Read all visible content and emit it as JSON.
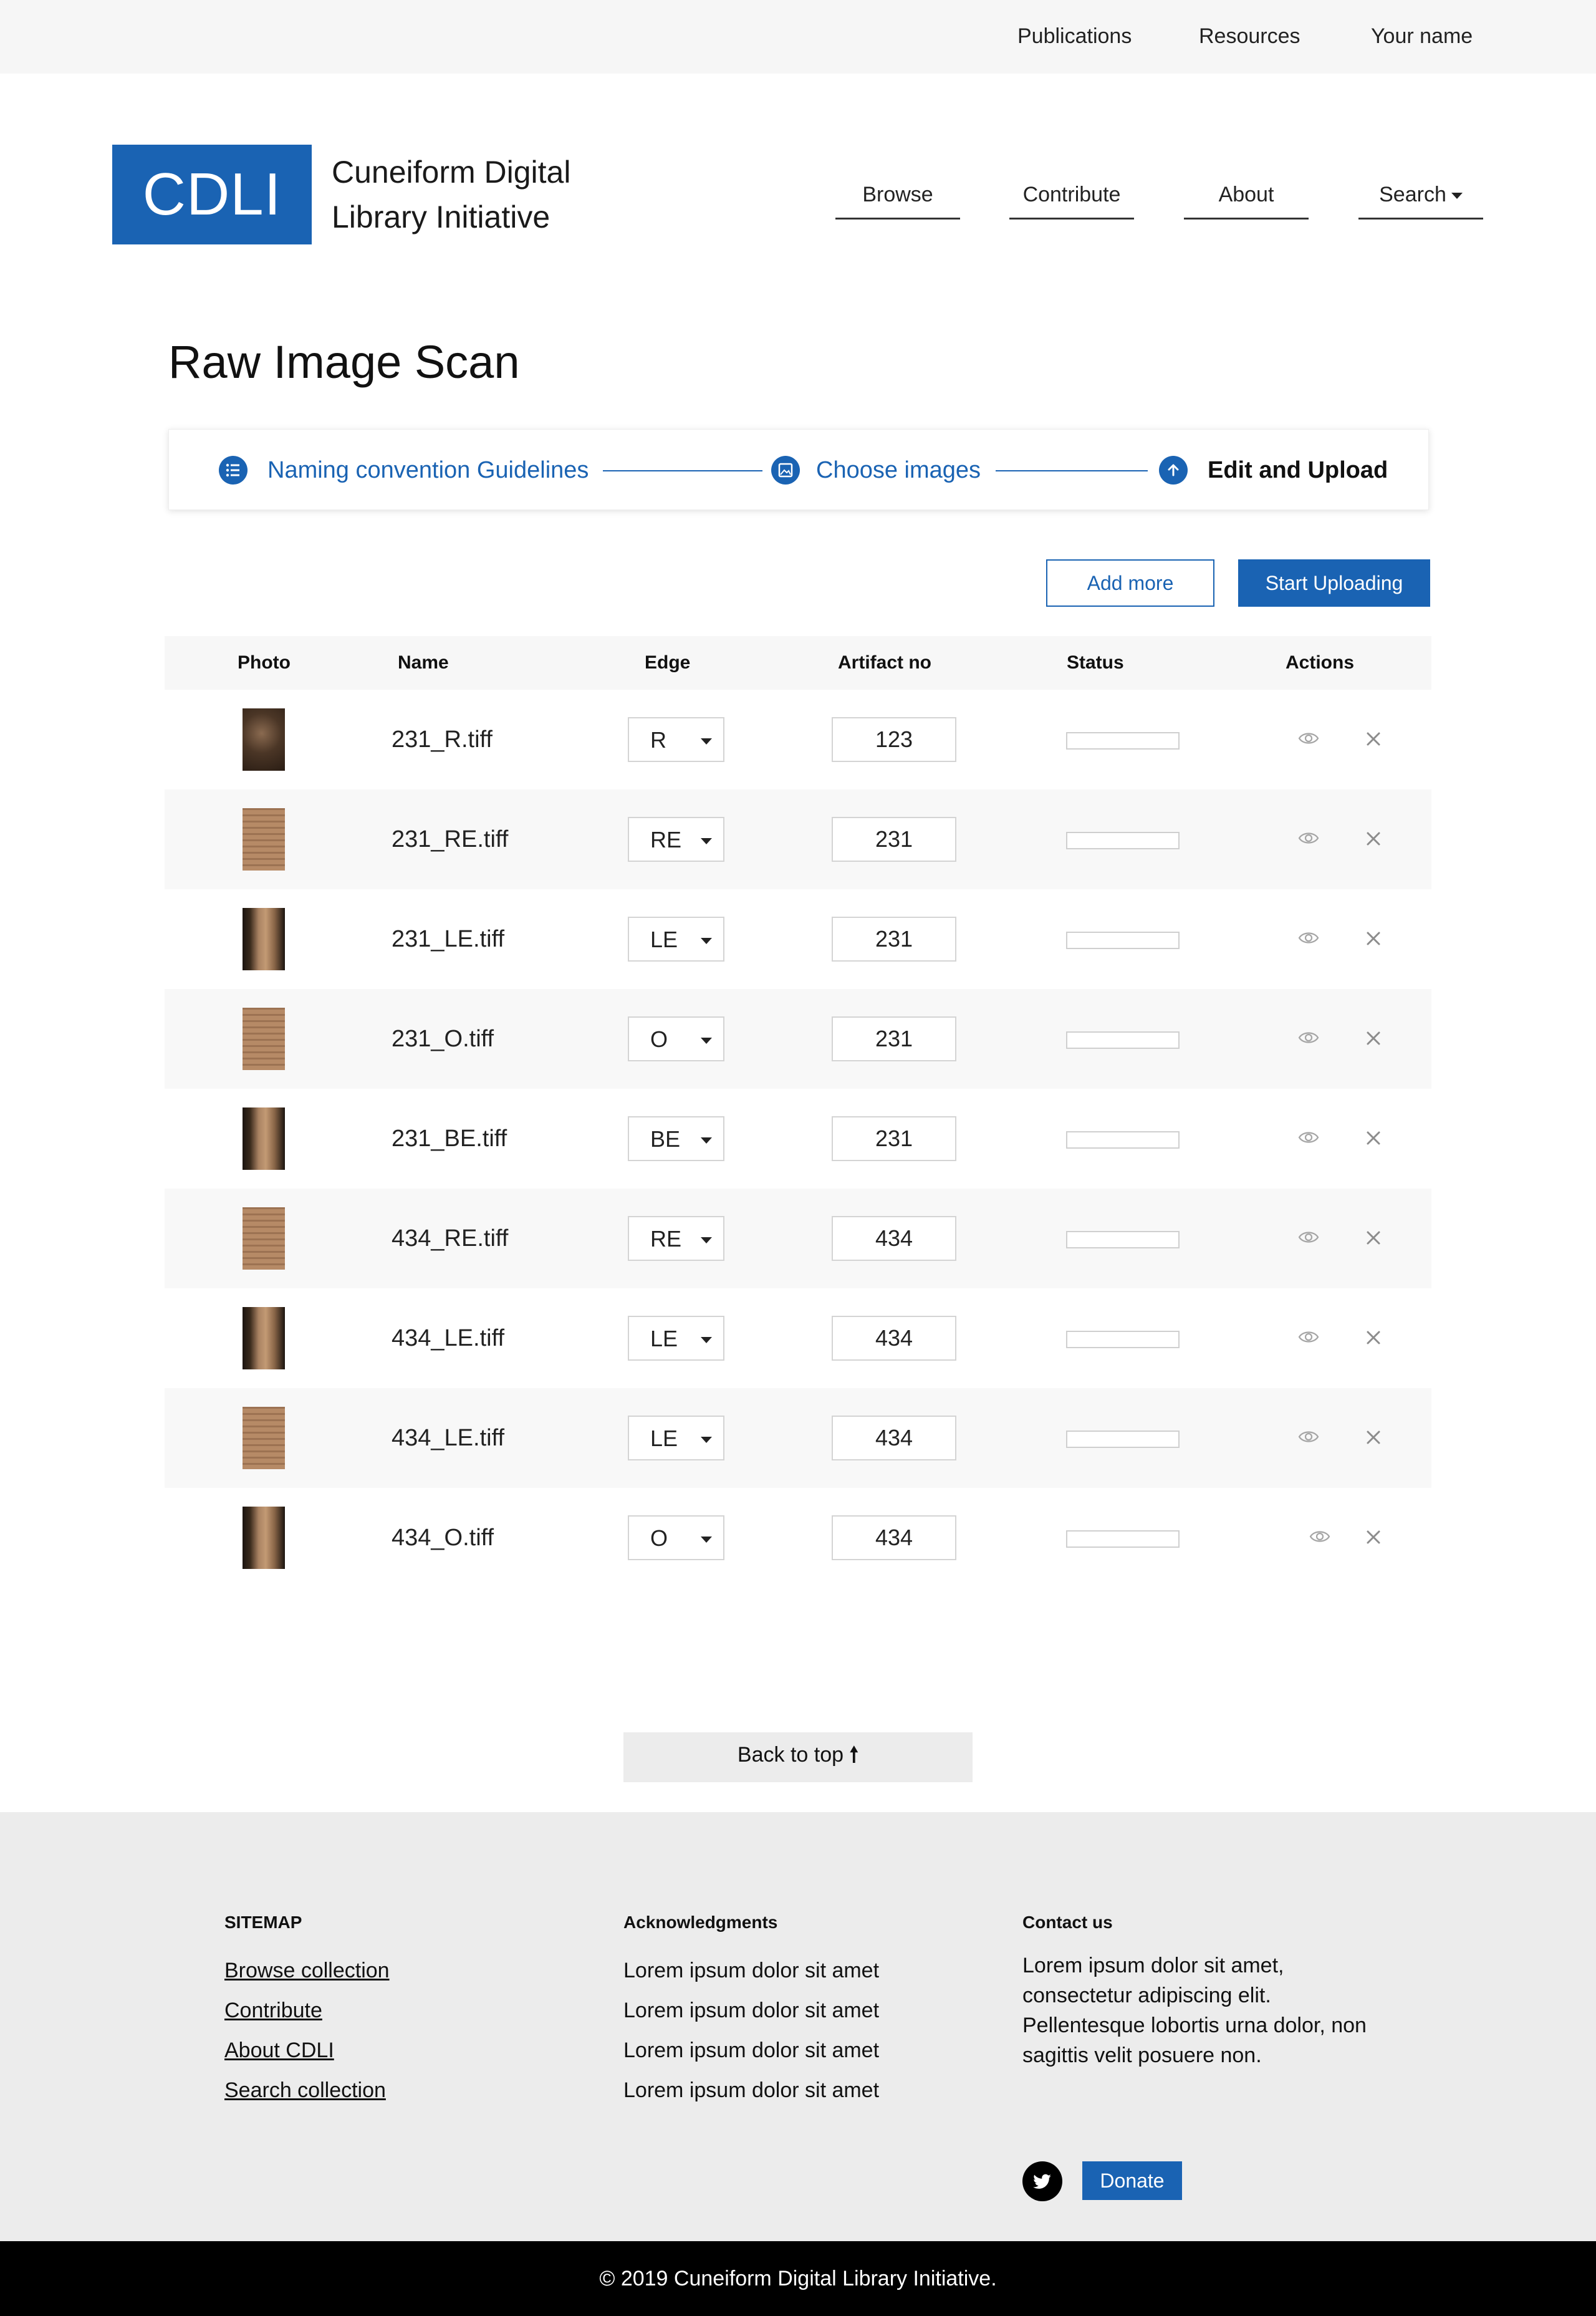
{
  "topbar": {
    "links": [
      "Publications",
      "Resources",
      "Your name"
    ]
  },
  "header": {
    "logo": "CDLI",
    "title_line1": "Cuneiform Digital",
    "title_line2": "Library Initiative",
    "nav": [
      "Browse",
      "Contribute",
      "About",
      "Search"
    ]
  },
  "page": {
    "title": "Raw Image Scan"
  },
  "stepper": {
    "steps": [
      {
        "label": "Naming convention Guidelines",
        "icon": "list-icon",
        "state": "done"
      },
      {
        "label": "Choose images",
        "icon": "image-icon",
        "state": "done"
      },
      {
        "label": "Edit and Upload",
        "icon": "upload-arrow-icon",
        "state": "active"
      }
    ]
  },
  "actions": {
    "add_more": "Add more",
    "start_uploading": "Start Uploading"
  },
  "table": {
    "headers": [
      "Photo",
      "Name",
      "Edge",
      "Artifact no",
      "Status",
      "Actions"
    ],
    "rows": [
      {
        "name": "231_R.tiff",
        "edge": "R",
        "artifact": "123"
      },
      {
        "name": "231_RE.tiff",
        "edge": "RE",
        "artifact": "231"
      },
      {
        "name": "231_LE.tiff",
        "edge": "LE",
        "artifact": "231"
      },
      {
        "name": "231_O.tiff",
        "edge": "O",
        "artifact": "231"
      },
      {
        "name": "231_BE.tiff",
        "edge": "BE",
        "artifact": "231"
      },
      {
        "name": "434_RE.tiff",
        "edge": "RE",
        "artifact": "434"
      },
      {
        "name": "434_LE.tiff",
        "edge": "LE",
        "artifact": "434"
      },
      {
        "name": "434_LE.tiff",
        "edge": "LE",
        "artifact": "434"
      },
      {
        "name": "434_O.tiff",
        "edge": "O",
        "artifact": "434"
      }
    ]
  },
  "back_to_top": "Back to top",
  "footer": {
    "sitemap": {
      "heading": "SITEMAP",
      "links": [
        "Browse collection",
        "Contribute",
        "About CDLI",
        "Search collection"
      ]
    },
    "acknowledgments": {
      "heading": "Acknowledgments",
      "items": [
        "Lorem ipsum dolor sit amet",
        "Lorem ipsum dolor sit amet",
        "Lorem ipsum dolor sit amet",
        "Lorem ipsum dolor sit amet"
      ]
    },
    "contact": {
      "heading": "Contact us",
      "text": "Lorem ipsum dolor sit amet, consectetur adipiscing elit. Pellentesque lobortis urna dolor, non sagittis velit posuere non.",
      "donate": "Donate"
    },
    "copyright": "© 2019 Cuneiform Digital Library Initiative."
  },
  "colors": {
    "brand": "#1a63b3",
    "footer_bg": "#ececec",
    "row_alt": "#f8f8f8"
  }
}
